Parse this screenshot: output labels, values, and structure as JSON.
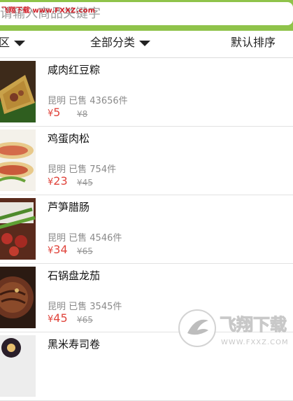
{
  "watermark": {
    "top_text": "飞翔下载 www.FXXZ.com",
    "logo_text": "飞翔下载",
    "logo_url": "WWW.FXXZ.COM"
  },
  "search": {
    "placeholder": "请输入商品关键字"
  },
  "filters": [
    {
      "label": "区"
    },
    {
      "label": "全部分类"
    },
    {
      "label": "默认排序"
    }
  ],
  "products": [
    {
      "name": "咸肉红豆粽",
      "city": "昆明",
      "sold": "已售 43656件",
      "currency": "¥",
      "price": "5",
      "original": "¥8"
    },
    {
      "name": "鸡蛋肉松",
      "city": "昆明",
      "sold": "已售 754件",
      "currency": "¥",
      "price": "23",
      "original": "¥45"
    },
    {
      "name": "芦笋腊肠",
      "city": "昆明",
      "sold": "已售 4546件",
      "currency": "¥",
      "price": "34",
      "original": "¥65"
    },
    {
      "name": "石锅盘龙茄",
      "city": "昆明",
      "sold": "已售 3545件",
      "currency": "¥",
      "price": "45",
      "original": "¥65"
    },
    {
      "name": "黑米寿司卷"
    }
  ],
  "colors": {
    "header": "#8fc34a",
    "price": "#e0453d",
    "watermark_red": "#d0212a"
  }
}
